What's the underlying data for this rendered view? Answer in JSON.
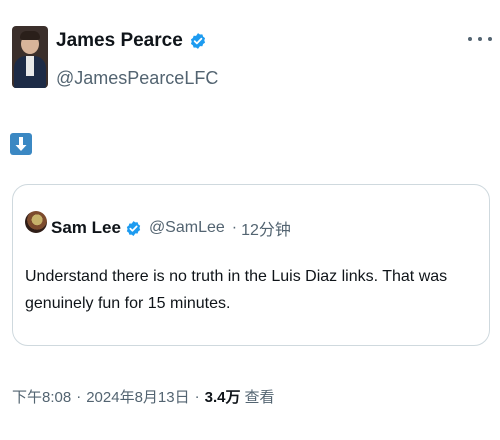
{
  "tweet": {
    "author": {
      "name": "James Pearce",
      "handle": "@JamesPearceLFC",
      "verified": true
    },
    "body_emoji": "down-arrow-emoji",
    "quoted": {
      "name": "Sam Lee",
      "handle": "@SamLee",
      "separator": "·",
      "time_ago": "12分钟",
      "text": "Understand there is no truth in the Luis Diaz links. That was genuinely fun for 15 minutes."
    },
    "meta": {
      "time": "下午8:08",
      "separator": "·",
      "date": "2024年8月13日",
      "views_count": "3.4万",
      "views_label": "查看"
    }
  },
  "colors": {
    "verified_blue": "#1d9bf0",
    "secondary_text": "#536471",
    "border": "#cfd9de"
  }
}
